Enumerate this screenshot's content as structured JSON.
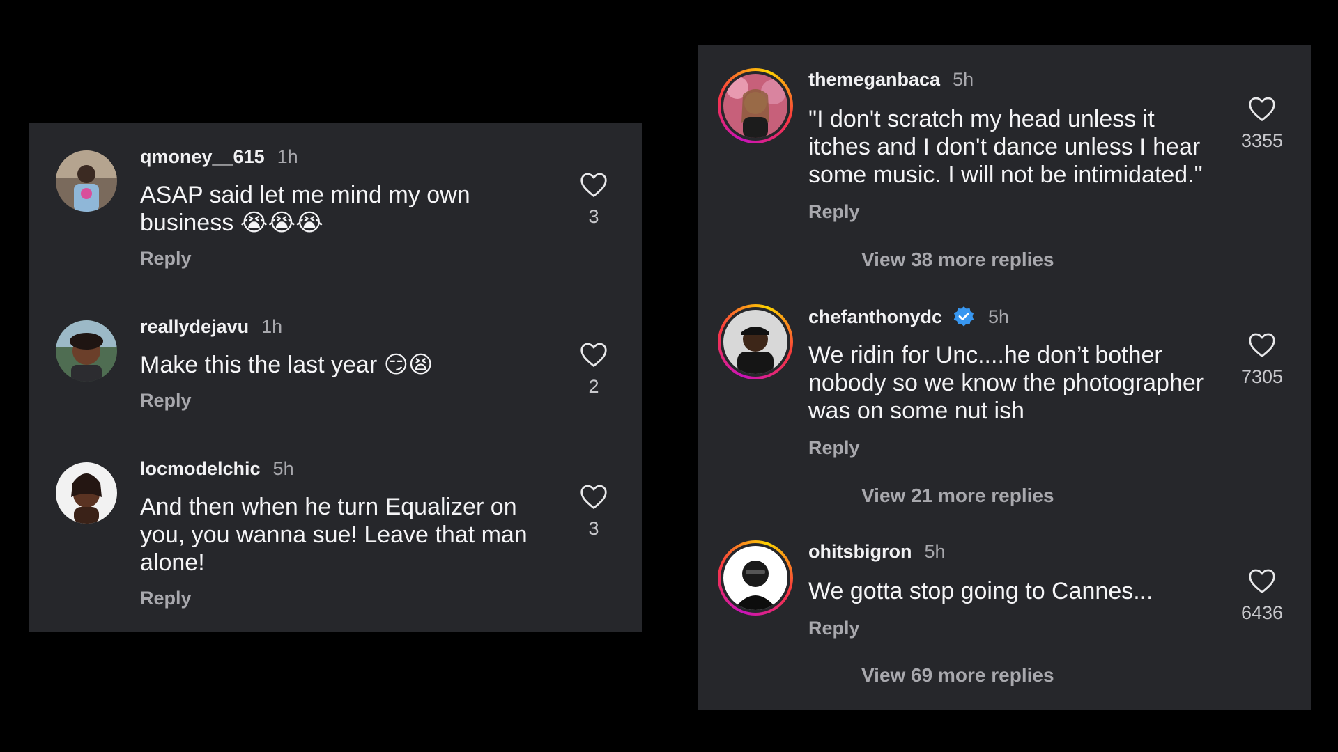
{
  "left_panel": {
    "comments": [
      {
        "username": "qmoney__615",
        "time": "1h",
        "lines": [
          "ASAP said let me mind my own",
          "business 😭😭😭"
        ],
        "reply_label": "Reply",
        "likes": "3"
      },
      {
        "username": "reallydejavu",
        "time": "1h",
        "lines": [
          "Make this the last year 😏😫"
        ],
        "reply_label": "Reply",
        "likes": "2"
      },
      {
        "username": "locmodelchic",
        "time": "5h",
        "lines": [
          "And then when he turn Equalizer on",
          "you, you wanna sue! Leave that man",
          "alone!"
        ],
        "reply_label": "Reply",
        "likes": "3"
      }
    ]
  },
  "right_panel": {
    "comments": [
      {
        "username": "themeganbaca",
        "time": "5h",
        "verified": false,
        "lines": [
          "\"I don't scratch my head unless it",
          "itches and I don't dance unless I hear",
          "some music. I will not be intimidated.\""
        ],
        "reply_label": "Reply",
        "likes": "3355",
        "view_more": "View 38 more replies"
      },
      {
        "username": "chefanthonydc",
        "time": "5h",
        "verified": true,
        "lines": [
          "We ridin for Unc....he don’t bother",
          "nobody so we know the photographer",
          "was on some nut ish"
        ],
        "reply_label": "Reply",
        "likes": "7305",
        "view_more": "View 21 more replies"
      },
      {
        "username": "ohitsbigron",
        "time": "5h",
        "verified": false,
        "lines": [
          "We gotta stop going to Cannes..."
        ],
        "reply_label": "Reply",
        "likes": "6436",
        "view_more": "View 69 more replies"
      }
    ]
  },
  "colors": {
    "background": "#000000",
    "panel": "#26272b",
    "primary_text": "#f4f4f6",
    "secondary_text": "#a8a8ad",
    "verified_badge": "#3897f0"
  },
  "icons": {
    "like": "heart-outline-icon",
    "verified": "verified-badge-icon"
  }
}
